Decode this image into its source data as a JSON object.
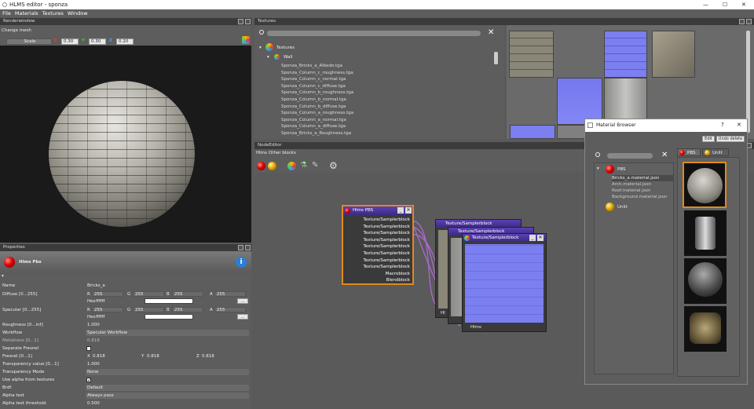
{
  "window": {
    "title": "HLMS editor - sponza",
    "minimize": "—",
    "maximize": "☐",
    "close": "✕"
  },
  "menu": [
    "File",
    "Materials",
    "Textures",
    "Window"
  ],
  "render": {
    "title": "Renderwindow",
    "change_mesh": "Change mesh",
    "scale_label": "Scale",
    "x": "X",
    "y": "Y",
    "z": "Z",
    "xv": "0.30",
    "yv": "0.30",
    "zv": "0.20"
  },
  "textures": {
    "title": "Textures",
    "root": "Textures",
    "group": "Wall",
    "files": [
      "Sponza_Bricks_a_Albedo.tga",
      "Sponza_Column_c_roughness.tga",
      "Sponza_Column_c_normal.tga",
      "Sponza_Column_c_diffuse.tga",
      "Sponza_Column_b_roughness.tga",
      "Sponza_Column_b_normal.tga",
      "Sponza_Column_b_diffuse.tga",
      "Sponza_Column_a_roughness.tga",
      "Sponza_Column_a_normal.tga",
      "Sponza_Column_a_diffuse.tga",
      "Sponza_Bricks_a_Roughness.tga"
    ]
  },
  "node": {
    "title": "NodeEditor",
    "tabs": [
      "Hlms",
      "Other blocks"
    ],
    "hlms_title": "Hlms PBS",
    "ports": [
      "Texture/Samplerblock",
      "Texture/Samplerblock",
      "Texture/Samplerblock",
      "Texture/Samplerblock",
      "Texture/Samplerblock",
      "Texture/Samplerblock",
      "Texture/Samplerblock",
      "Texture/Samplerblock",
      "Macroblock",
      "Blendblock"
    ],
    "tb1": "Texture/Samplerblock",
    "tb2": "Texture/Samplerblock",
    "tb3": "Texture/Samplerblock",
    "hlms_port": "Hlms",
    "hlms_port_short": "Hl"
  },
  "props": {
    "title": "Properties",
    "header": "Hlms Pbs",
    "rows": [
      {
        "k": "Name",
        "v": "Bricks_a"
      },
      {
        "k": "Diffuse [0...255]",
        "r": "255",
        "g": "255",
        "b": "255",
        "a": "255",
        "hex": "ffffff"
      },
      {
        "k": "Specular [0...255]",
        "r": "255",
        "g": "255",
        "b": "255",
        "a": "255",
        "hex": "ffffff"
      },
      {
        "k": "Roughness [0...inf]",
        "v": "1.000"
      },
      {
        "k": "Workflow",
        "v": "Specular Workflow"
      },
      {
        "k": "Metalness [0...1]",
        "v": "0.818"
      },
      {
        "k": "Separate Fresnel",
        "v": ""
      },
      {
        "k": "Fresnel [0...1]",
        "x": "0.818",
        "y": "0.818",
        "z": "0.818"
      },
      {
        "k": "Transparency value [0...1]",
        "v": "1.000"
      },
      {
        "k": "Transparency Mode",
        "v": "None"
      },
      {
        "k": "Use alpha from textures",
        "v": ""
      },
      {
        "k": "Brdf",
        "v": "Default"
      },
      {
        "k": "Alpha test",
        "v": "Always pass"
      },
      {
        "k": "Alpha test threshold",
        "v": "0.500"
      }
    ],
    "R": "R",
    "G": "G",
    "B": "B",
    "A": "A",
    "Hex": "Hex",
    "X": "X",
    "Y": "Y",
    "Z": "Z",
    "dots": "..."
  },
  "matbrowser": {
    "title": "Material Browser",
    "help": "?",
    "close": "✕",
    "edit": "Edit",
    "undo": "Undo delete",
    "tab_pbs": "PBS",
    "tab_unlit": "Unlit",
    "pbs": "PBS",
    "unlit": "Unlit",
    "items": [
      "Bricks_a.material.json",
      "Arch.material.json",
      "Roof.material.json",
      "Background.material.json"
    ]
  }
}
